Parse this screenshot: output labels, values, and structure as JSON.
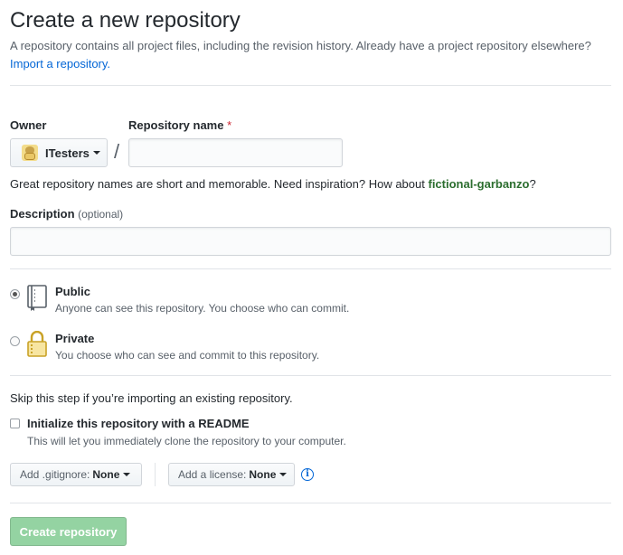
{
  "header": {
    "title": "Create a new repository",
    "intro_text": "A repository contains all project files, including the revision history. Already have a project repository elsewhere?",
    "import_link": "Import a repository."
  },
  "owner": {
    "label": "Owner",
    "selected": "ITesters",
    "avatar_icon": "itesters-avatar"
  },
  "separator": "/",
  "repo_name": {
    "label": "Repository name",
    "required_mark": "*",
    "value": "",
    "placeholder": ""
  },
  "name_hint": {
    "text": "Great repository names are short and memorable. Need inspiration? How about",
    "suggestion": "fictional-garbanzo",
    "suffix": "?"
  },
  "description": {
    "label": "Description",
    "optional": "(optional)",
    "value": "",
    "placeholder": ""
  },
  "visibility": {
    "selected": "public",
    "options": [
      {
        "id": "public",
        "title": "Public",
        "description": "Anyone can see this repository. You choose who can commit.",
        "icon": "book-icon"
      },
      {
        "id": "private",
        "title": "Private",
        "description": "You choose who can see and commit to this repository.",
        "icon": "lock-icon"
      }
    ]
  },
  "init": {
    "skip_text": "Skip this step if you’re importing an existing repository.",
    "readme_label": "Initialize this repository with a README",
    "readme_desc": "This will let you immediately clone the repository to your computer.",
    "readme_checked": false
  },
  "gitignore": {
    "label": "Add .gitignore:",
    "value": "None"
  },
  "license": {
    "label": "Add a license:",
    "value": "None"
  },
  "submit": {
    "label": "Create repository",
    "enabled": false
  },
  "colors": {
    "link": "#0366d6",
    "required": "#cb2431",
    "suggestion": "#2c6e2f",
    "create_button_disabled": "#94d3a2"
  }
}
